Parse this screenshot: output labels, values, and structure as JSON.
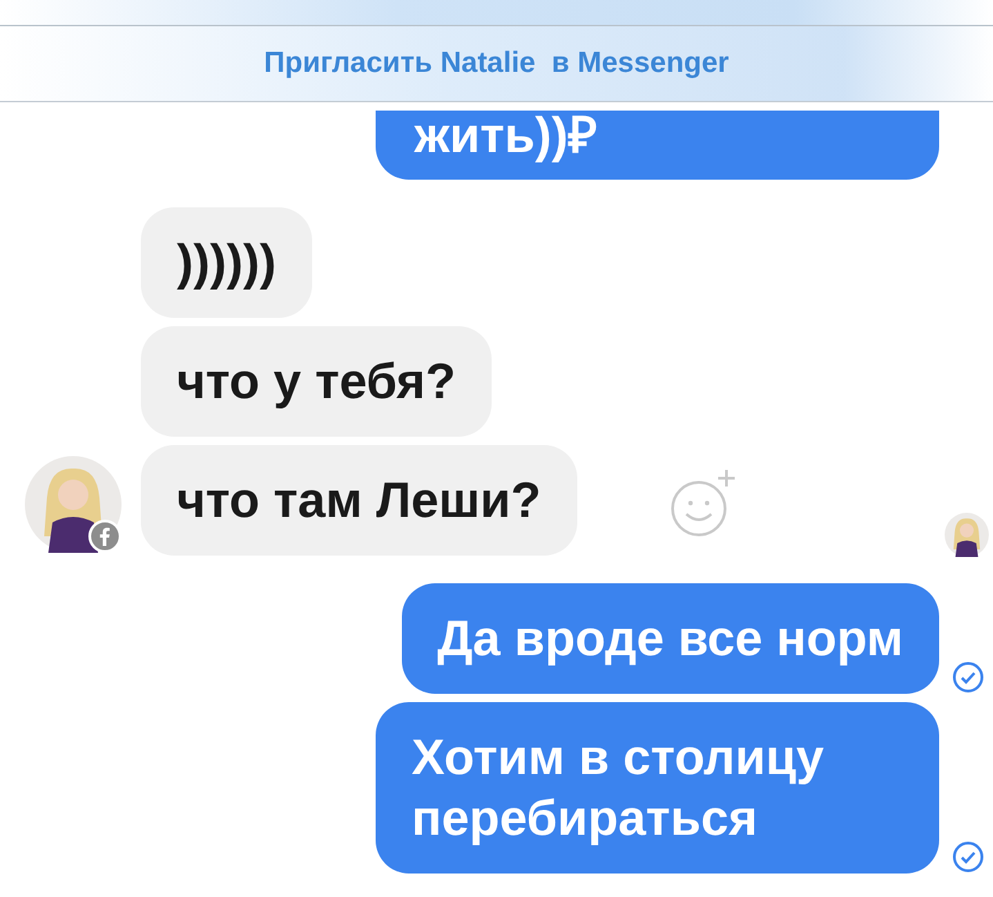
{
  "invite_banner": {
    "text": "Пригласить Natalie  в Messenger"
  },
  "messages": [
    {
      "kind": "outgoing",
      "text": "жить))₽",
      "read": false,
      "cut": true
    },
    {
      "kind": "incoming",
      "text": "))))))",
      "read": false,
      "cut": false
    },
    {
      "kind": "incoming",
      "text": "что у тебя?",
      "read": false,
      "cut": false
    },
    {
      "kind": "incoming",
      "text": "что там Леши?",
      "read": false,
      "cut": false
    },
    {
      "kind": "outgoing",
      "text": "Да вроде все норм",
      "read": true,
      "cut": false
    },
    {
      "kind": "outgoing",
      "text": "Хотим в столицу перебираться",
      "read": true,
      "cut": false
    }
  ]
}
